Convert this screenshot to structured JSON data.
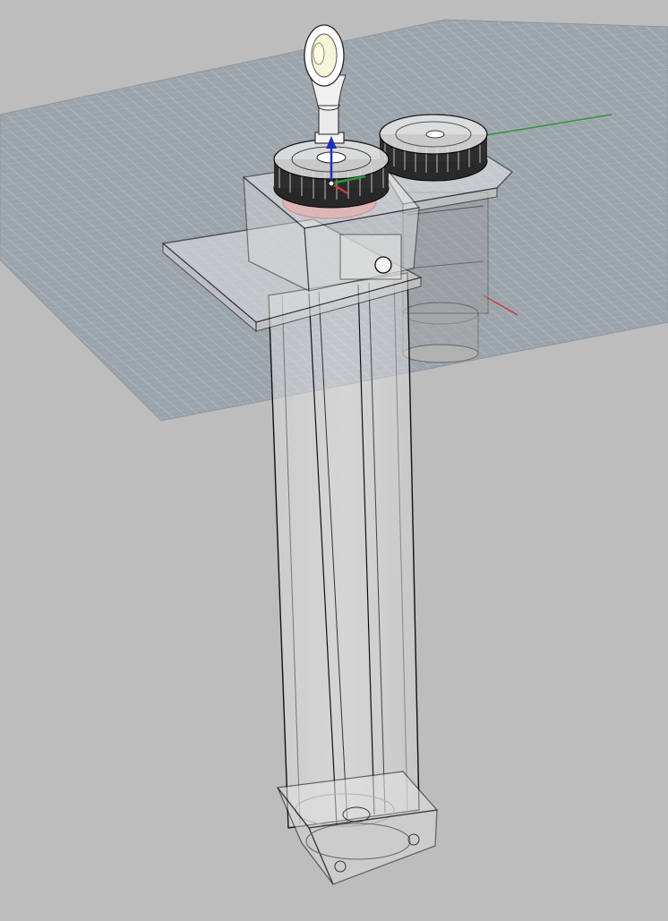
{
  "viewport": {
    "view": "perspective-3d",
    "display_mode": "x-ray / ghosted",
    "grid_visible": true
  },
  "colors": {
    "background": "#bdbdbd",
    "grid_fill": "#9aa2ab",
    "grid_line": "#c7cdd3",
    "axis_x": "#c83b3b",
    "axis_y": "#2f9a3a",
    "gumball_z": "#1f2fb8",
    "outline": "#101010",
    "ghost_fill": "#e6e6e6"
  },
  "model": {
    "parts": [
      "rod-end-eye",
      "lead-screw-pulley",
      "motor-pulley",
      "stepper-motor",
      "top-mount-plate",
      "motor-bracket",
      "column-tube",
      "base-block"
    ]
  },
  "icons": [
    "gumball-widget",
    "world-origin-axes"
  ]
}
